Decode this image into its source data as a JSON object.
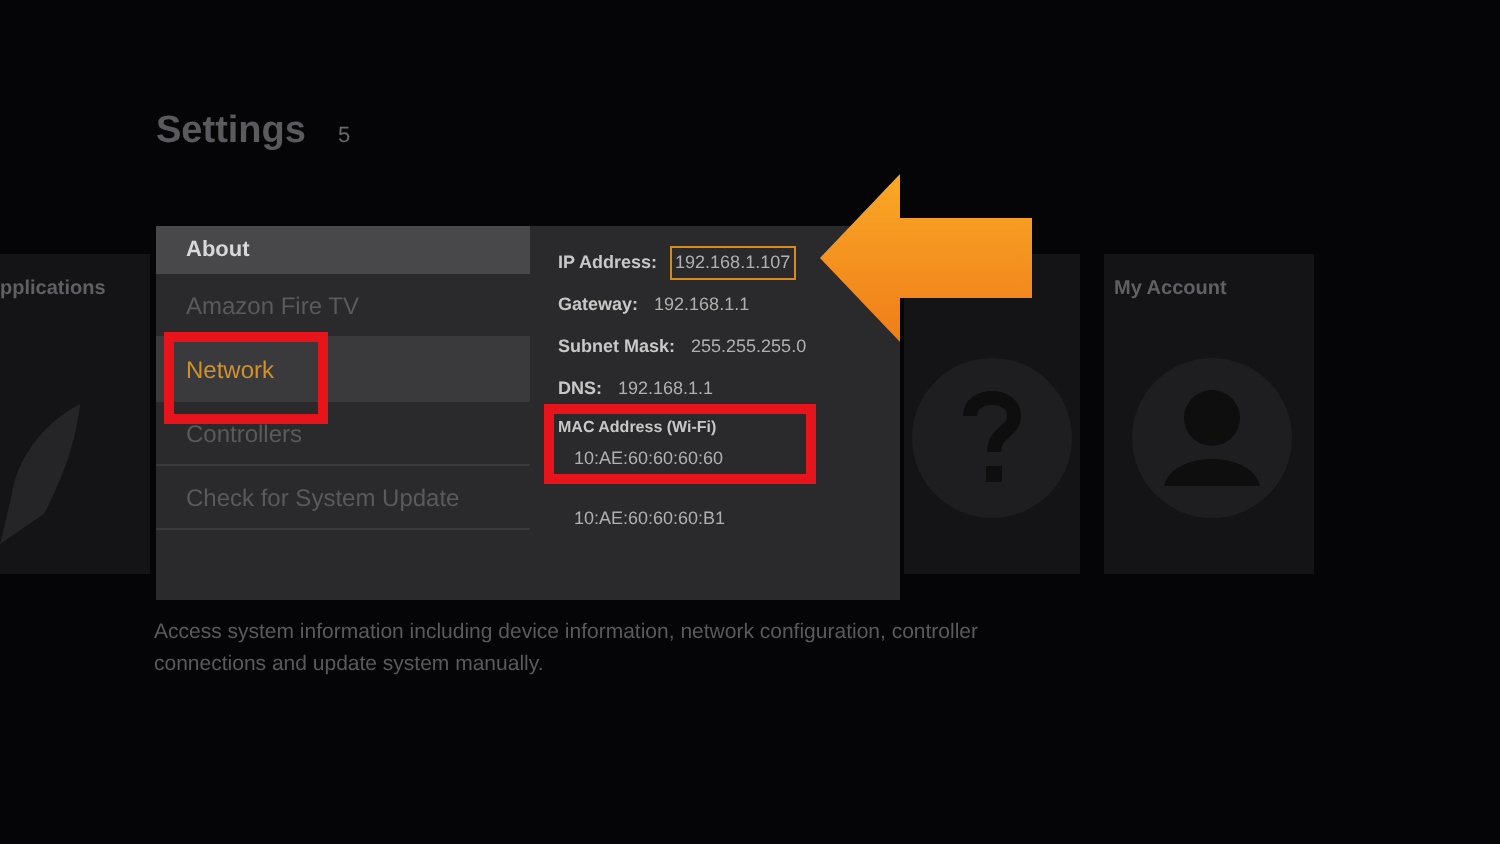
{
  "title": "Settings",
  "title_badge": "5",
  "background_tiles": [
    {
      "kind": "rocket",
      "label": "pplications"
    },
    {
      "kind": "help"
    },
    {
      "kind": "account",
      "label": "My Account"
    }
  ],
  "menu": {
    "header": "About",
    "items": [
      {
        "label": "Amazon Fire TV",
        "selected": false,
        "annotated": false
      },
      {
        "label": "Network",
        "selected": true,
        "annotated": true
      },
      {
        "label": "Controllers",
        "selected": false,
        "annotated": false
      },
      {
        "label": "Check for System Update",
        "selected": false,
        "annotated": false
      }
    ]
  },
  "details": [
    {
      "label": "IP Address:",
      "value": "192.168.1.107",
      "highlighted": true
    },
    {
      "label": "Gateway:",
      "value": "192.168.1.1",
      "highlighted": false
    },
    {
      "label": "Subnet Mask:",
      "value": "255.255.255.0",
      "highlighted": false
    },
    {
      "label": "DNS:",
      "value": "192.168.1.1",
      "highlighted": false
    }
  ],
  "mac": {
    "label": "MAC Address (Wi-Fi)",
    "value": "10:AE:60:60:60:60",
    "annotated": true
  },
  "mac_other": "10:AE:60:60:60:B1",
  "description": "Access system information including device information, network configuration, controller connections and update system manually."
}
